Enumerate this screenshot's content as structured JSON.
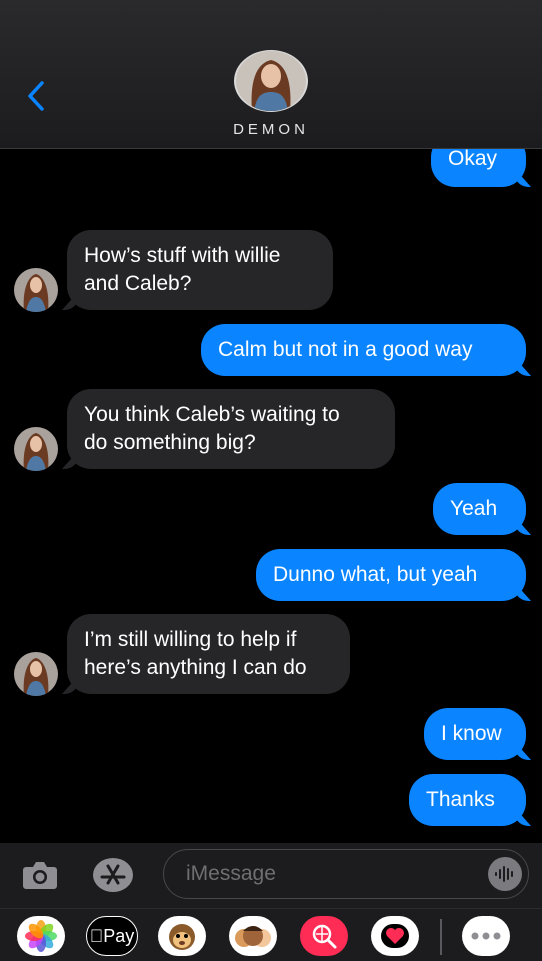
{
  "header": {
    "contact_name": "DEMON",
    "back_icon": "chevron-left-icon"
  },
  "messages": [
    {
      "side": "out",
      "text": "Okay"
    },
    {
      "side": "in",
      "text": "How’s stuff with willie\nand Caleb?"
    },
    {
      "side": "out",
      "text": "Calm but not in a good way"
    },
    {
      "side": "in",
      "text": "You think Caleb’s waiting to\ndo something big?"
    },
    {
      "side": "out",
      "text": "Yeah"
    },
    {
      "side": "out",
      "text": "Dunno what, but yeah"
    },
    {
      "side": "in",
      "text": "I’m still willing to help if\nhere’s anything I can do"
    },
    {
      "side": "out",
      "text": "I know"
    },
    {
      "side": "out",
      "text": "Thanks"
    }
  ],
  "input": {
    "placeholder": "iMessage",
    "camera_icon": "camera-icon",
    "appstore_icon": "app-store-icon",
    "audio_icon": "audio-waveform-icon"
  },
  "app_drawer": {
    "apple_pay_label": "Pay",
    "apps": [
      "photos-icon",
      "apple-pay-icon",
      "animoji-icon",
      "memoji-icon",
      "web-search-icon",
      "digital-touch-icon",
      "more-apps-icon"
    ]
  },
  "colors": {
    "outgoing": "#0a84ff",
    "incoming": "#262629",
    "background": "#000000"
  }
}
